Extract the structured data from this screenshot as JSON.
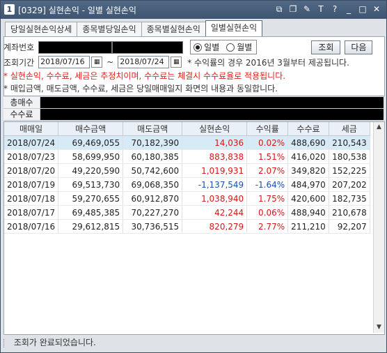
{
  "window": {
    "app_icon": "1",
    "title": "[0329] 실현손익 - 일별 실현손익",
    "icons": [
      "restore-icon",
      "copy-icon",
      "link-icon",
      "font-size-icon",
      "help-icon",
      "minimize-icon",
      "maximize-icon",
      "close-icon"
    ],
    "icon_glyphs": [
      "⧉",
      "❐",
      "✎",
      "T",
      "?",
      "_",
      "□",
      "✕"
    ]
  },
  "tabs": [
    {
      "label": "당일실현손익상세"
    },
    {
      "label": "종목별당일손익"
    },
    {
      "label": "종목별실현손익"
    },
    {
      "label": "일별실현손익"
    }
  ],
  "form": {
    "account_label": "계좌번호",
    "radio_daily": "일별",
    "radio_monthly": "월별",
    "query_button": "조회",
    "next_button": "다음",
    "period_label": "조회기간",
    "date_from": "2018/07/16",
    "date_sep": "~",
    "date_to": "2018/07/24",
    "period_note": "* 수익률의 경우 2016년 3월부터 제공됩니다.",
    "note_red": "* 실현손익, 수수료, 세금은 추정치이며, 수수료는 체결시 수수료율로 적용됩니다.",
    "note_black": "* 매입금액, 매도금액, 수수료, 세금은 당일매매일지 화면의 내용과 동일합니다."
  },
  "summary": {
    "total_label": "총매수",
    "fee_label": "수수료"
  },
  "table": {
    "headers": [
      "매매일",
      "매수금액",
      "매도금액",
      "실현손익",
      "수익률",
      "수수료",
      "세금"
    ],
    "rows": [
      {
        "date": "2018/07/24",
        "buy": "69,469,055",
        "sell": "70,182,390",
        "pnl": "14,036",
        "rate": "0.02%",
        "fee": "488,690",
        "tax": "210,543",
        "sign": "pos"
      },
      {
        "date": "2018/07/23",
        "buy": "58,699,950",
        "sell": "60,180,385",
        "pnl": "883,838",
        "rate": "1.51%",
        "fee": "416,020",
        "tax": "180,538",
        "sign": "pos"
      },
      {
        "date": "2018/07/20",
        "buy": "49,220,590",
        "sell": "50,742,600",
        "pnl": "1,019,931",
        "rate": "2.07%",
        "fee": "349,820",
        "tax": "152,225",
        "sign": "pos"
      },
      {
        "date": "2018/07/19",
        "buy": "69,513,730",
        "sell": "69,068,350",
        "pnl": "-1,137,549",
        "rate": "-1.64%",
        "fee": "484,970",
        "tax": "207,202",
        "sign": "neg"
      },
      {
        "date": "2018/07/18",
        "buy": "59,270,655",
        "sell": "60,912,870",
        "pnl": "1,038,940",
        "rate": "1.75%",
        "fee": "420,600",
        "tax": "182,735",
        "sign": "pos"
      },
      {
        "date": "2018/07/17",
        "buy": "69,485,385",
        "sell": "70,227,270",
        "pnl": "42,244",
        "rate": "0.06%",
        "fee": "488,940",
        "tax": "210,678",
        "sign": "pos"
      },
      {
        "date": "2018/07/16",
        "buy": "29,612,815",
        "sell": "30,736,515",
        "pnl": "820,279",
        "rate": "2.77%",
        "fee": "211,210",
        "tax": "92,207",
        "sign": "pos"
      }
    ]
  },
  "status": {
    "message": "조회가 완료되었습니다."
  },
  "colors": {
    "positive": "#d21a1a",
    "negative": "#1a4fb0",
    "selected_row": "#d7ebf7",
    "titlebar": "#445a76"
  }
}
